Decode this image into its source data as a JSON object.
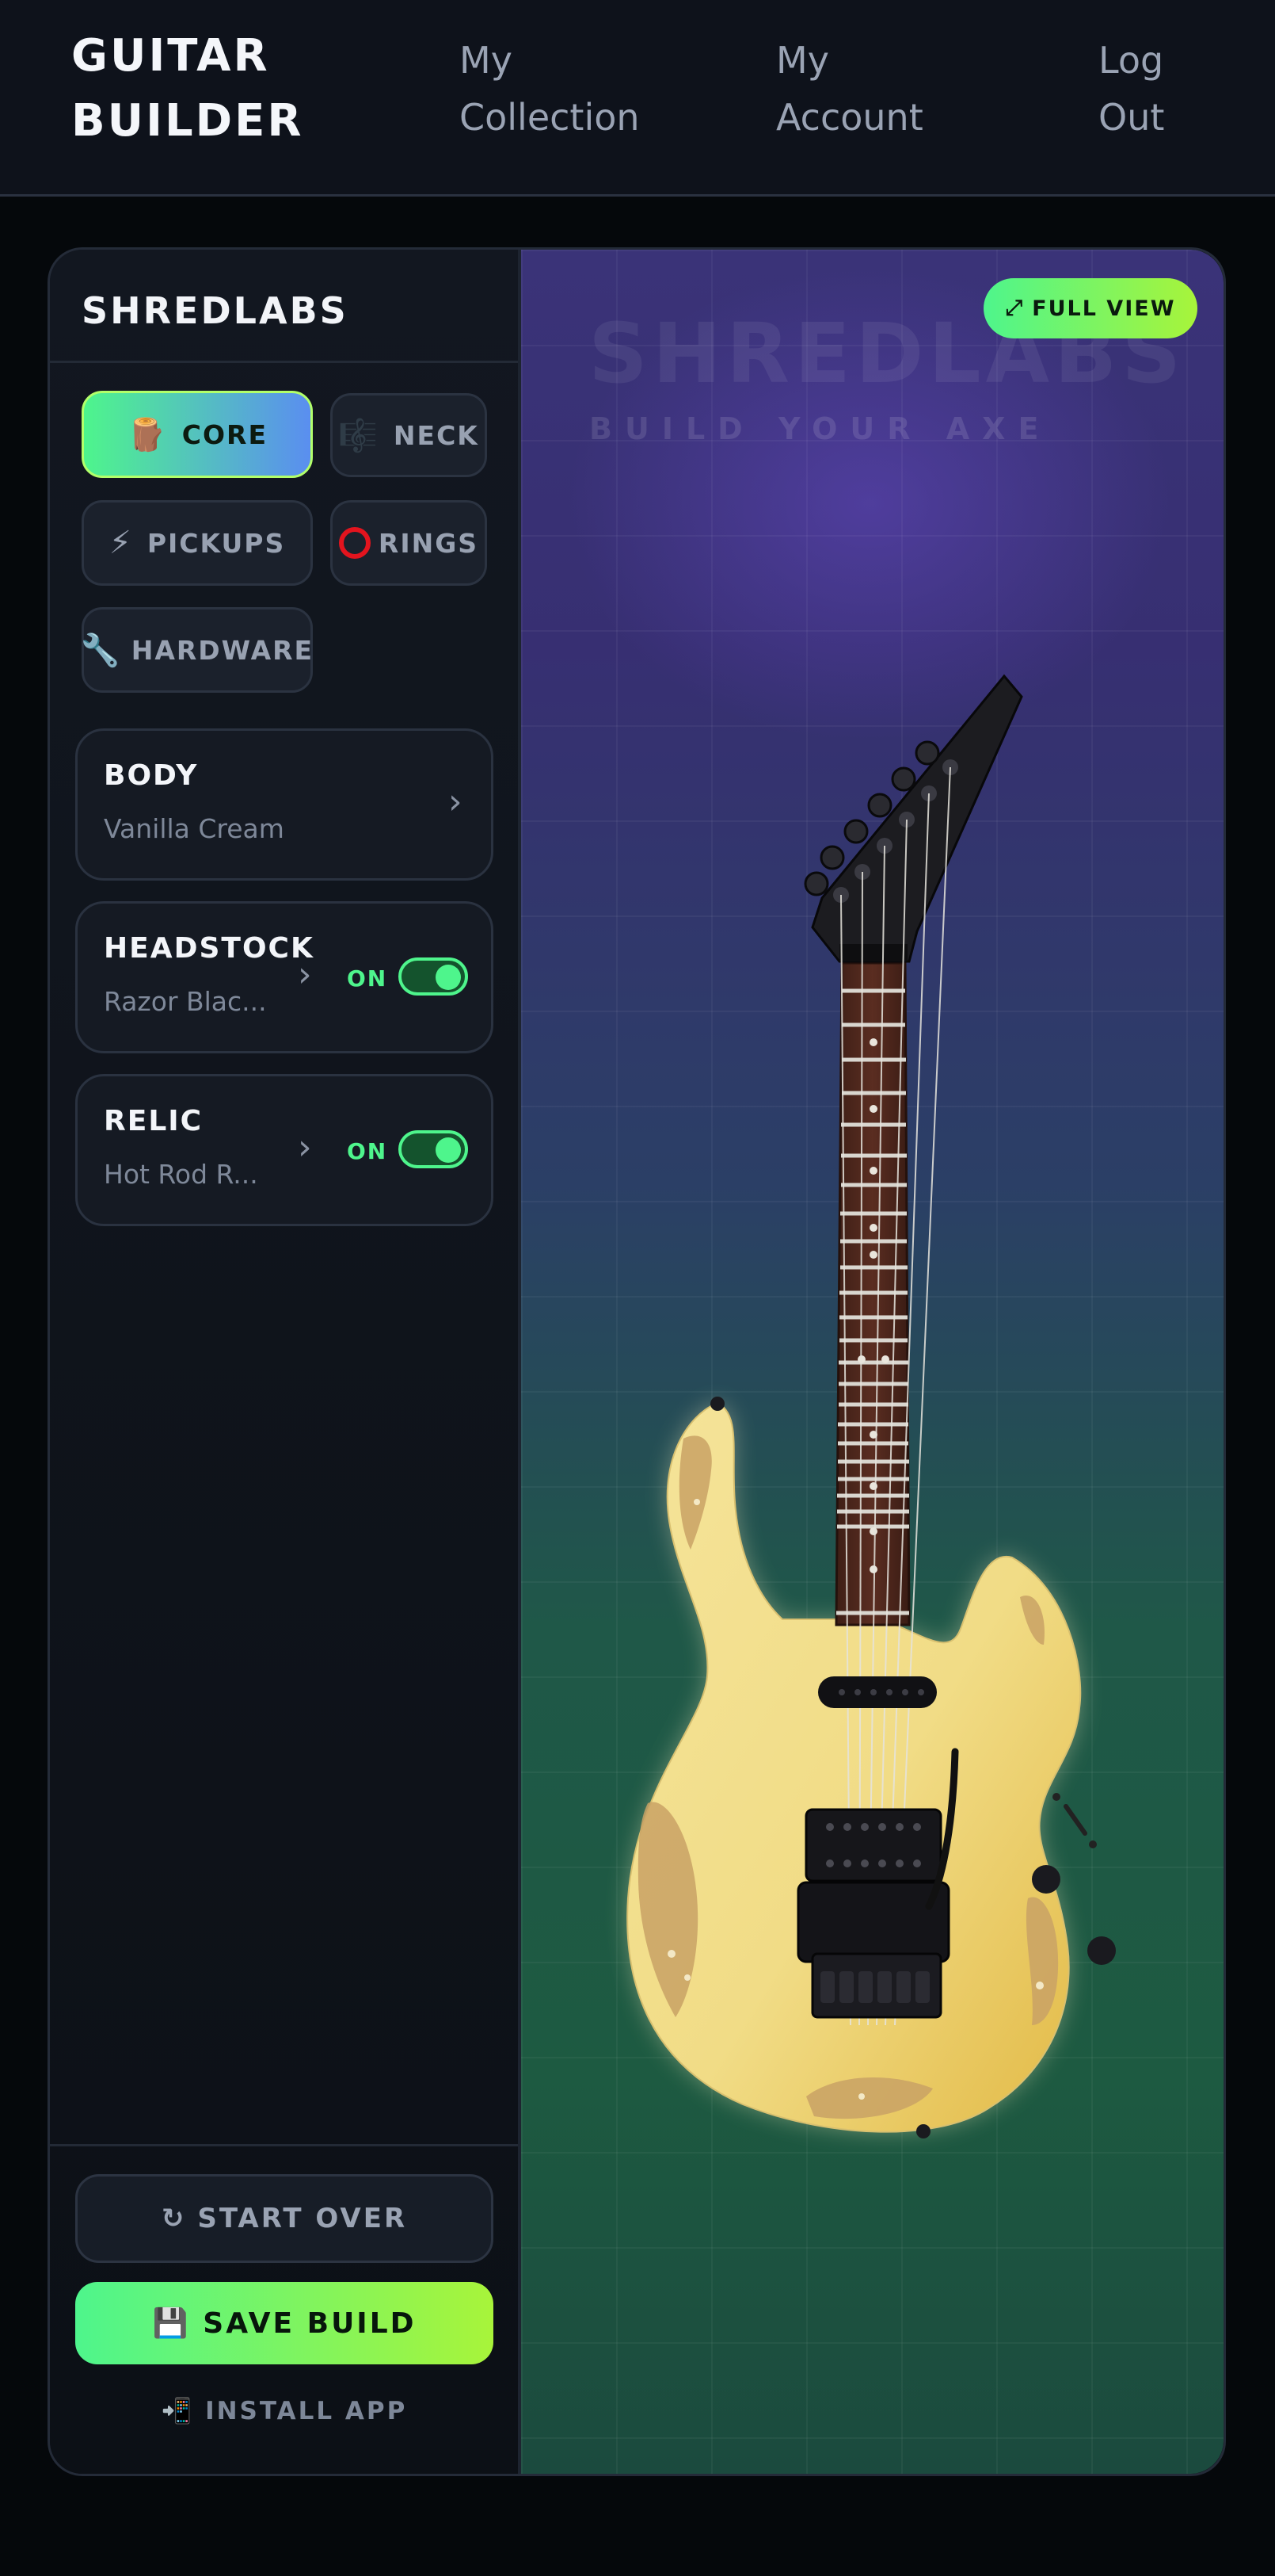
{
  "nav": {
    "brand_line1": "GUITAR",
    "brand_line2": "BUILDER",
    "collection_line1": "My",
    "collection_line2": "Collection",
    "account_line1": "My",
    "account_line2": "Account",
    "logout_line1": "Log",
    "logout_line2": "Out"
  },
  "sidebar": {
    "title": "SHREDLABS",
    "tabs": [
      {
        "label": "CORE",
        "icon": "wood-log-icon",
        "active": true
      },
      {
        "label": "NECK",
        "icon": "sheet-music-icon",
        "active": false
      },
      {
        "label": "PICKUPS",
        "icon": "lightning-icon",
        "active": false
      },
      {
        "label": "RINGS",
        "icon": "ring-icon",
        "active": false
      },
      {
        "label": "HARDWARE",
        "icon": "wrench-icon",
        "active": false
      }
    ],
    "options": [
      {
        "title": "BODY",
        "value": "Vanilla Cream"
      },
      {
        "title": "HEADSTOCK",
        "value": "Razor Blac...",
        "toggle_label": "ON",
        "toggle_on": true
      },
      {
        "title": "RELIC",
        "value": "Hot Rod R...",
        "toggle_label": "ON",
        "toggle_on": true
      }
    ],
    "start_over": "START OVER",
    "save_build": "SAVE BUILD",
    "install_app": "INSTALL APP"
  },
  "preview": {
    "watermark_title": "SHREDLABS",
    "watermark_sub": "BUILD YOUR AXE",
    "full_view": "FULL VIEW"
  },
  "colors": {
    "accent_green": "#4ef58c",
    "accent_lime": "#a8f43a",
    "body_cream": "#f2de8a",
    "background": "#05080b"
  }
}
